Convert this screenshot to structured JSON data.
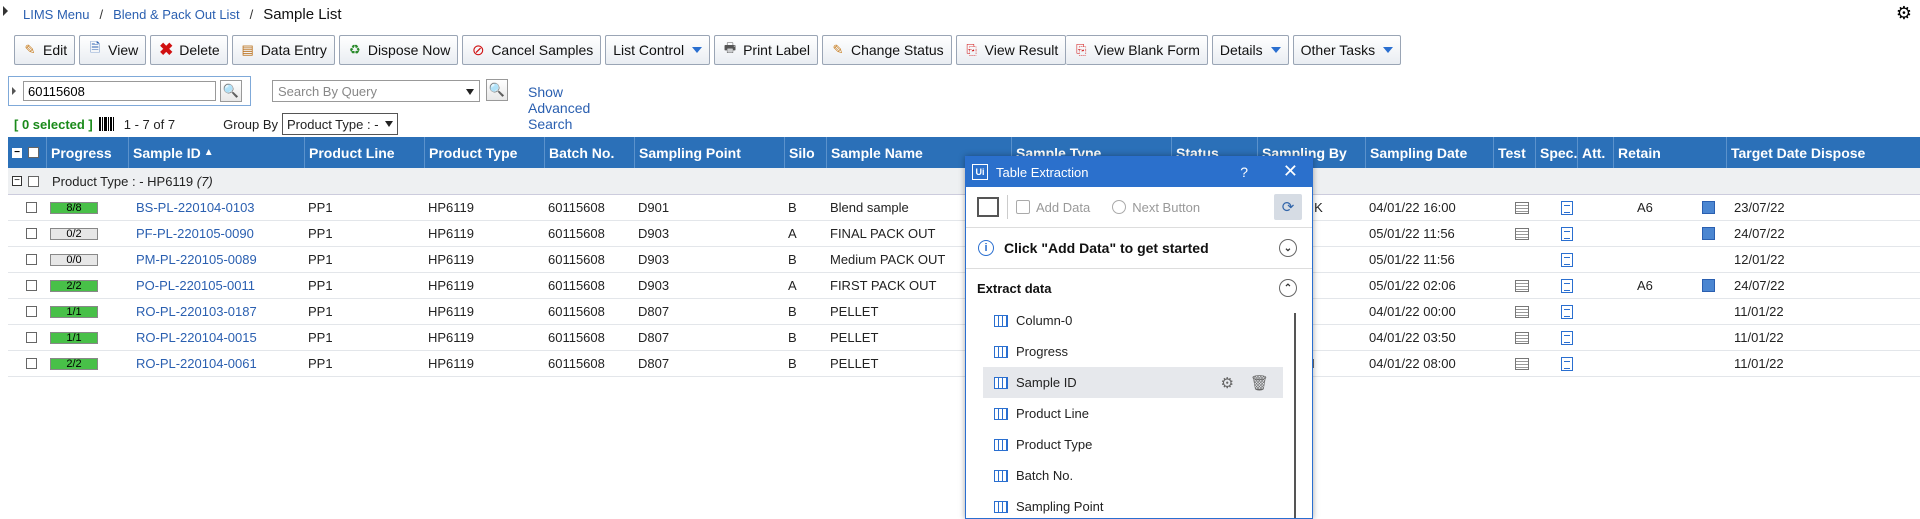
{
  "breadcrumb": {
    "items": [
      "LIMS Menu",
      "Blend & Pack Out List"
    ],
    "current": "Sample List"
  },
  "toolbar": {
    "edit": "Edit",
    "view": "View",
    "delete": "Delete",
    "data_entry": "Data Entry",
    "dispose_now": "Dispose Now",
    "cancel_samples": "Cancel Samples",
    "list_control": "List Control",
    "print_label": "Print Label",
    "change_status": "Change Status",
    "view_result": "View Result",
    "view_blank_form": "View Blank Form",
    "details": "Details",
    "other_tasks": "Other Tasks"
  },
  "search": {
    "value": "60115608",
    "query_placeholder": "Search By Query",
    "advanced": "Show Advanced Search"
  },
  "info": {
    "selected": "[ 0 selected ]",
    "range": "1 - 7 of 7",
    "group_by_label": "Group By",
    "group_by_value": "Product Type : -"
  },
  "columns": [
    "Progress",
    "Sample ID",
    "Product Line",
    "Product Type",
    "Batch No.",
    "Sampling Point",
    "Silo",
    "Sample Name",
    "Sample Type",
    "Status",
    "Sampling By",
    "Sampling Date",
    "Test",
    "Spec.",
    "Att.",
    "Retain",
    "Target Date Dispose"
  ],
  "group": {
    "label": "Product Type : - HP6119",
    "count": "(7)"
  },
  "rows": [
    {
      "progress": "8/8",
      "progress_pct": 1.0,
      "sample_id": "BS-PL-220104-0103",
      "product_line": "PP1",
      "product_type": "HP6119",
      "batch": "60115608",
      "point": "D901",
      "silo": "B",
      "name": "Blend sample",
      "sampling_by_tail": "c.K",
      "date": "04/01/22 16:00",
      "retain": "A6",
      "dispose": "23/07/22"
    },
    {
      "progress": "0/2",
      "progress_pct": 0.0,
      "sample_id": "PF-PL-220105-0090",
      "product_line": "PP1",
      "product_type": "HP6119",
      "batch": "60115608",
      "point": "D903",
      "silo": "A",
      "name": "FINAL PACK OUT",
      "sampling_by_tail": "",
      "date": "05/01/22 11:56",
      "retain": "",
      "dispose": "24/07/22"
    },
    {
      "progress": "0/0",
      "progress_pct": 0.0,
      "sample_id": "PM-PL-220105-0089",
      "product_line": "PP1",
      "product_type": "HP6119",
      "batch": "60115608",
      "point": "D903",
      "silo": "B",
      "name": "Medium PACK OUT",
      "sampling_by_tail": "",
      "date": "05/01/22 11:56",
      "retain": "",
      "dispose": "12/01/22"
    },
    {
      "progress": "2/2",
      "progress_pct": 1.0,
      "sample_id": "PO-PL-220105-0011",
      "product_line": "PP1",
      "product_type": "HP6119",
      "batch": "60115608",
      "point": "D903",
      "silo": "A",
      "name": "FIRST PACK OUT",
      "sampling_by_tail": "",
      "date": "05/01/22 02:06",
      "retain": "A6",
      "dispose": "24/07/22"
    },
    {
      "progress": "1/1",
      "progress_pct": 1.0,
      "sample_id": "RO-PL-220103-0187",
      "product_line": "PP1",
      "product_type": "HP6119",
      "batch": "60115608",
      "point": "D807",
      "silo": "B",
      "name": "PELLET",
      "sampling_by_tail": "",
      "date": "04/01/22 00:00",
      "retain": "",
      "dispose": "11/01/22"
    },
    {
      "progress": "1/1",
      "progress_pct": 1.0,
      "sample_id": "RO-PL-220104-0015",
      "product_line": "PP1",
      "product_type": "HP6119",
      "batch": "60115608",
      "point": "D807",
      "silo": "B",
      "name": "PELLET",
      "sampling_by_tail": "",
      "date": "04/01/22 03:50",
      "retain": "",
      "dispose": "11/01/22"
    },
    {
      "progress": "2/2",
      "progress_pct": 1.0,
      "sample_id": "RO-PL-220104-0061",
      "product_line": "PP1",
      "product_type": "HP6119",
      "batch": "60115608",
      "point": "D807",
      "silo": "B",
      "name": "PELLET",
      "sampling_by_tail": "..I",
      "date": "04/01/22 08:00",
      "retain": "",
      "dispose": "11/01/22"
    }
  ],
  "dialog": {
    "title": "Table Extraction",
    "help": "?",
    "close": "✕",
    "add_data": "Add Data",
    "next_button": "Next Button",
    "hint": "Click \"Add Data\" to get started",
    "section": "Extract data",
    "fields": [
      "Column-0",
      "Progress",
      "Sample ID",
      "Product Line",
      "Product Type",
      "Batch No.",
      "Sampling Point"
    ],
    "selected_field": "Sample ID"
  },
  "colors": {
    "header_blue": "#2b70b8",
    "progress_green": "#48c048",
    "link_blue": "#2a5fb0",
    "selected_green": "#1a8a1a"
  }
}
